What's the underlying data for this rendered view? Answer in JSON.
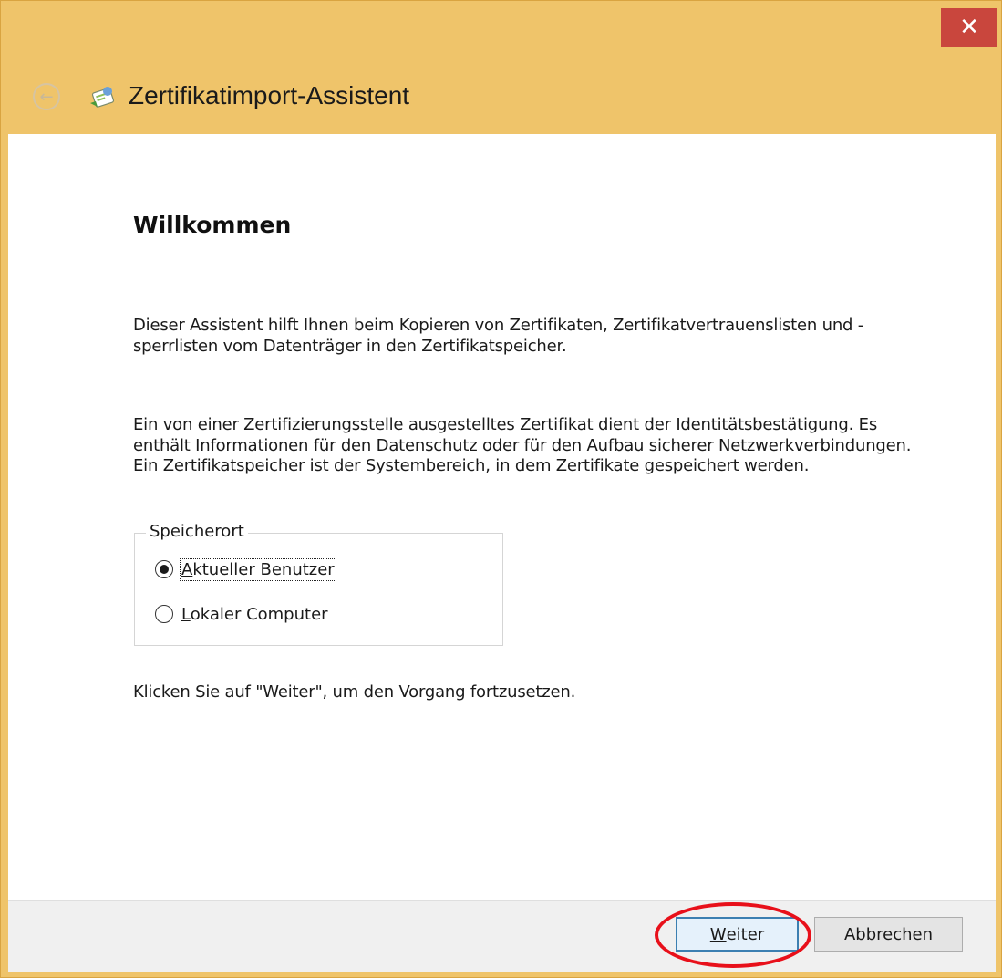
{
  "window": {
    "title": "Zertifikatimport-Assistent",
    "close_glyph": "✕",
    "back_glyph": "←",
    "icons": {
      "close": "close-icon",
      "back": "back-arrow-icon",
      "app": "certificate-wizard-icon"
    },
    "colors": {
      "titlebar": "#efc46a",
      "close": "#c9463d",
      "highlight": "#e8101a"
    }
  },
  "content": {
    "heading": "Willkommen",
    "intro": "Dieser Assistent hilft Ihnen beim Kopieren von Zertifikaten, Zertifikatvertrauenslisten und -sperrlisten vom Datenträger in den Zertifikatspeicher.",
    "description": "Ein von einer Zertifizierungsstelle ausgestelltes Zertifikat dient der Identitätsbestätigung. Es enthält Informationen für den Datenschutz oder für den Aufbau sicherer Netzwerkverbindungen. Ein Zertifikatspeicher ist der Systembereich, in dem Zertifikate gespeichert werden.",
    "store_location": {
      "legend": "Speicherort",
      "options": [
        {
          "accel": "A",
          "rest": "ktueller Benutzer",
          "selected": true
        },
        {
          "accel": "L",
          "rest": "okaler Computer",
          "selected": false
        }
      ]
    },
    "continue_hint": "Klicken Sie auf \"Weiter\", um den Vorgang fortzusetzen."
  },
  "footer": {
    "next": {
      "accel": "W",
      "rest": "eiter"
    },
    "cancel": "Abbrechen"
  }
}
